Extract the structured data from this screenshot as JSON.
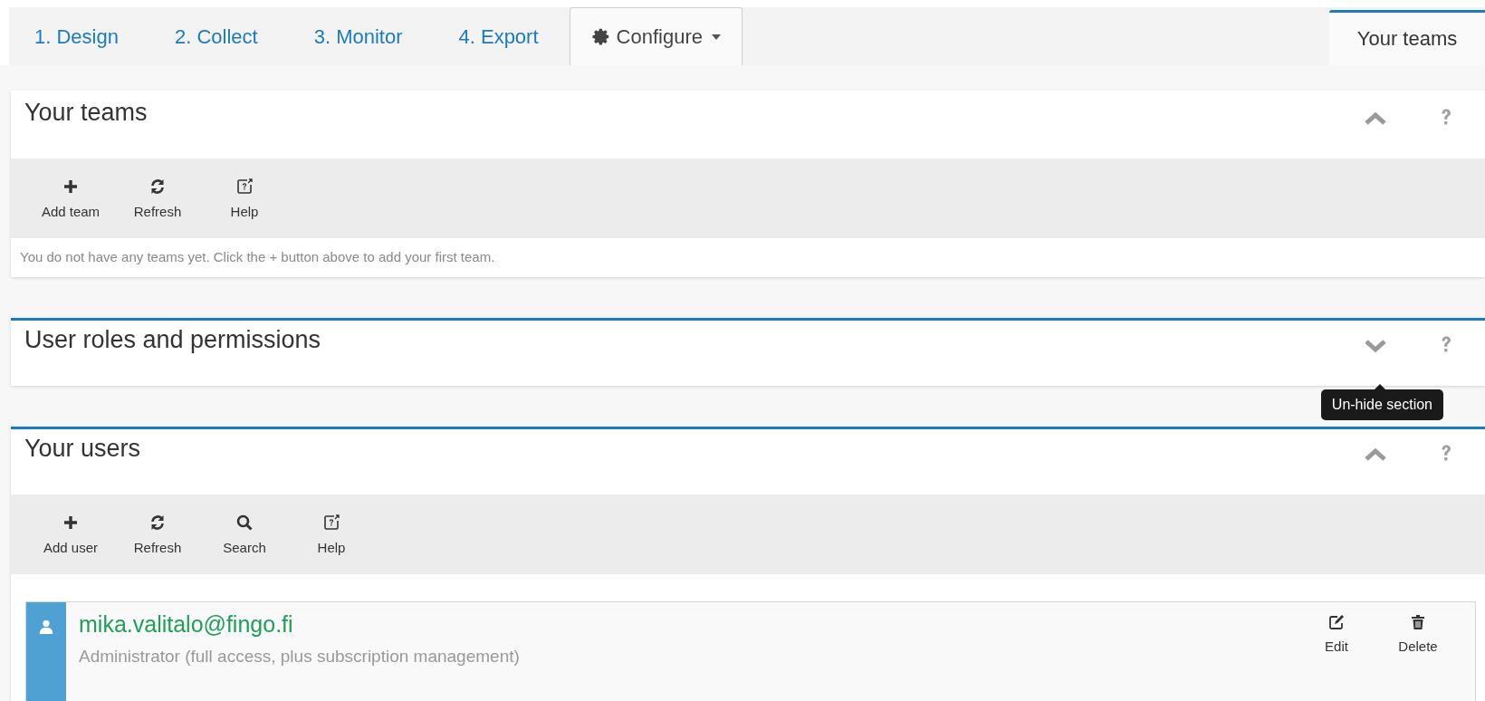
{
  "tabs": [
    {
      "label": "1. Design",
      "selected": false,
      "kind": "link"
    },
    {
      "label": "2. Collect",
      "selected": false,
      "kind": "link"
    },
    {
      "label": "3. Monitor",
      "selected": false,
      "kind": "link"
    },
    {
      "label": "4. Export",
      "selected": false,
      "kind": "link"
    },
    {
      "label": "Configure",
      "selected": true,
      "kind": "menu"
    }
  ],
  "side_tab": {
    "label": "Your teams"
  },
  "sections": [
    {
      "title": "Your teams",
      "expanded": true,
      "accent": false,
      "toolbar": [
        {
          "label": "Add team",
          "kind": "plus"
        },
        {
          "label": "Refresh",
          "kind": "refresh"
        },
        {
          "label": "Help",
          "kind": "help"
        }
      ],
      "message": "You do not have any teams yet. Click the + button above to add your first team."
    },
    {
      "title": "User roles and permissions",
      "expanded": false,
      "accent": true,
      "tooltip": "Un-hide section"
    },
    {
      "title": "Your users",
      "expanded": true,
      "accent": true,
      "toolbar": [
        {
          "label": "Add user",
          "kind": "plus"
        },
        {
          "label": "Refresh",
          "kind": "refresh"
        },
        {
          "label": "Search",
          "kind": "search"
        },
        {
          "label": "Help",
          "kind": "help"
        }
      ],
      "users": [
        {
          "email": "mika.valitalo@fingo.fi",
          "role": "Administrator (full access, plus subscription management)",
          "actions": [
            {
              "label": "Edit",
              "kind": "edit"
            },
            {
              "label": "Delete",
              "kind": "trash"
            }
          ]
        }
      ]
    }
  ]
}
